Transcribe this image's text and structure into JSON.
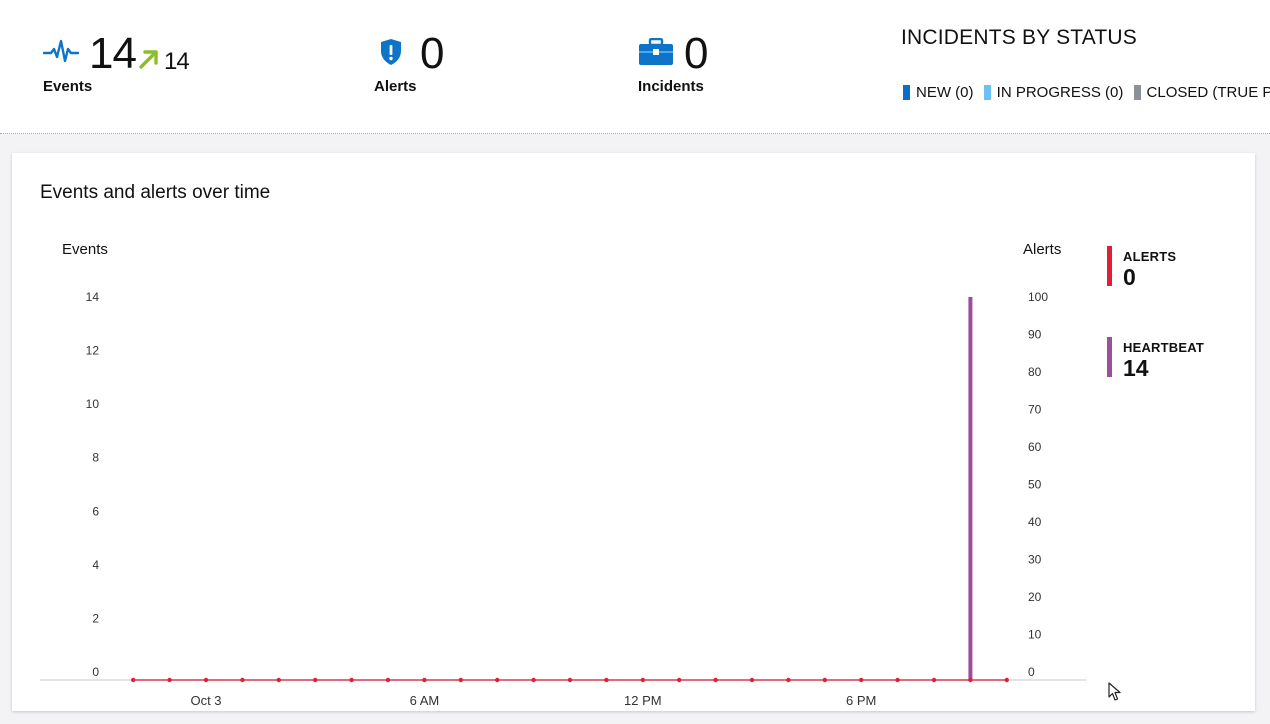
{
  "summary": {
    "events": {
      "value": "14",
      "trend_value": "14",
      "label": "Events",
      "icon": "heartbeat-pulse-icon",
      "trend_icon": "arrow-up-right-icon"
    },
    "alerts": {
      "value": "0",
      "label": "Alerts",
      "icon": "shield-exclamation-icon"
    },
    "incidents": {
      "value": "0",
      "label": "Incidents",
      "icon": "briefcase-icon"
    }
  },
  "incidents_by_status": {
    "title": "INCIDENTS BY STATUS",
    "items": [
      {
        "label": "NEW (0)",
        "color": "#0b6ec8"
      },
      {
        "label": "IN PROGRESS (0)",
        "color": "#6cc1f2"
      },
      {
        "label": "CLOSED (TRUE POSITI",
        "color": "#8a919b"
      }
    ]
  },
  "card": {
    "title": "Events and alerts over time",
    "left_axis_title": "Events",
    "right_axis_title": "Alerts"
  },
  "chart_data": {
    "type": "bar",
    "title": "Events and alerts over time",
    "left_axis": {
      "label": "Events",
      "range": [
        0,
        14
      ],
      "ticks": [
        0,
        2,
        4,
        6,
        8,
        10,
        12,
        14
      ]
    },
    "right_axis": {
      "label": "Alerts",
      "range": [
        0,
        100
      ],
      "ticks": [
        0,
        10,
        20,
        30,
        40,
        50,
        60,
        70,
        80,
        90,
        100
      ]
    },
    "x_ticks": [
      {
        "label": "Oct 3",
        "hour": 0
      },
      {
        "label": "6 AM",
        "hour": 6
      },
      {
        "label": "12 PM",
        "hour": 12
      },
      {
        "label": "6 PM",
        "hour": 18
      }
    ],
    "series": [
      {
        "name": "HEARTBEAT",
        "axis": "left",
        "color": "#9b4f9b",
        "points": [
          {
            "hour": 21,
            "value": 14
          }
        ]
      },
      {
        "name": "ALERTS",
        "axis": "right",
        "color": "#e01e37",
        "hours": [
          -2,
          -1,
          0,
          1,
          2,
          3,
          4,
          5,
          6,
          7,
          8,
          9,
          10,
          11,
          12,
          13,
          14,
          15,
          16,
          17,
          18,
          19,
          20,
          21,
          22
        ],
        "values": [
          0,
          0,
          0,
          0,
          0,
          0,
          0,
          0,
          0,
          0,
          0,
          0,
          0,
          0,
          0,
          0,
          0,
          0,
          0,
          0,
          0,
          0,
          0,
          0,
          0
        ]
      }
    ],
    "grid": false,
    "legend_position": "right"
  },
  "side_legend": [
    {
      "name": "ALERTS",
      "value": "0",
      "color": "#e01e37"
    },
    {
      "name": "HEARTBEAT",
      "value": "14",
      "color": "#9b4f9b"
    }
  ]
}
